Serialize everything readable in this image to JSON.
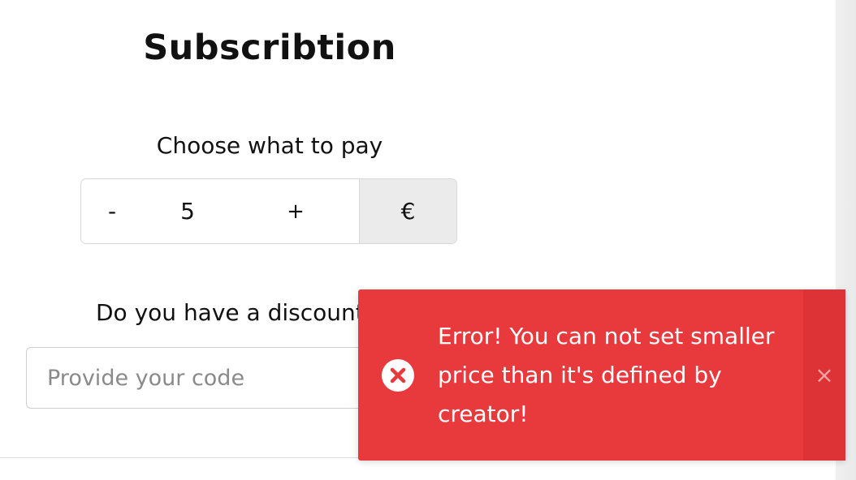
{
  "subscription": {
    "title": "Subscribtion",
    "price_label": "Choose what to pay",
    "stepper": {
      "decrement_label": "-",
      "value": "5",
      "increment_label": "+",
      "currency": "€"
    },
    "discount": {
      "label": "Do you have a discount code?",
      "input_value": "",
      "placeholder": "Provide your code"
    }
  },
  "toast": {
    "type": "error",
    "message": "Error! You can not set smaller price than it's defined by creator!",
    "icon": "error-circle-x-icon",
    "close_icon": "close-icon",
    "close_label": "×",
    "color": "#e8393c"
  }
}
